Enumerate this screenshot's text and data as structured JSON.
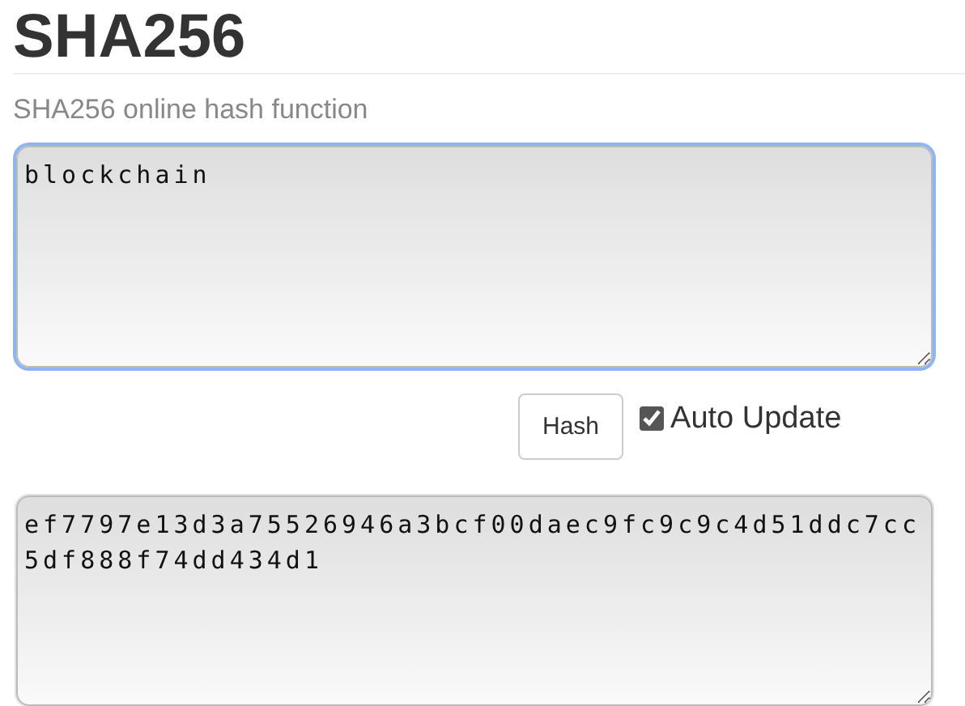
{
  "title": "SHA256",
  "subtitle": "SHA256 online hash function",
  "input": {
    "value": "blockchain",
    "focused": true
  },
  "hash_button": "Hash",
  "auto_update": {
    "label": "Auto Update",
    "checked": true
  },
  "output": {
    "value": "ef7797e13d3a75526946a3bcf00daec9fc9c9c4d51ddc7cc5df888f74dd434d1",
    "focused": false
  }
}
